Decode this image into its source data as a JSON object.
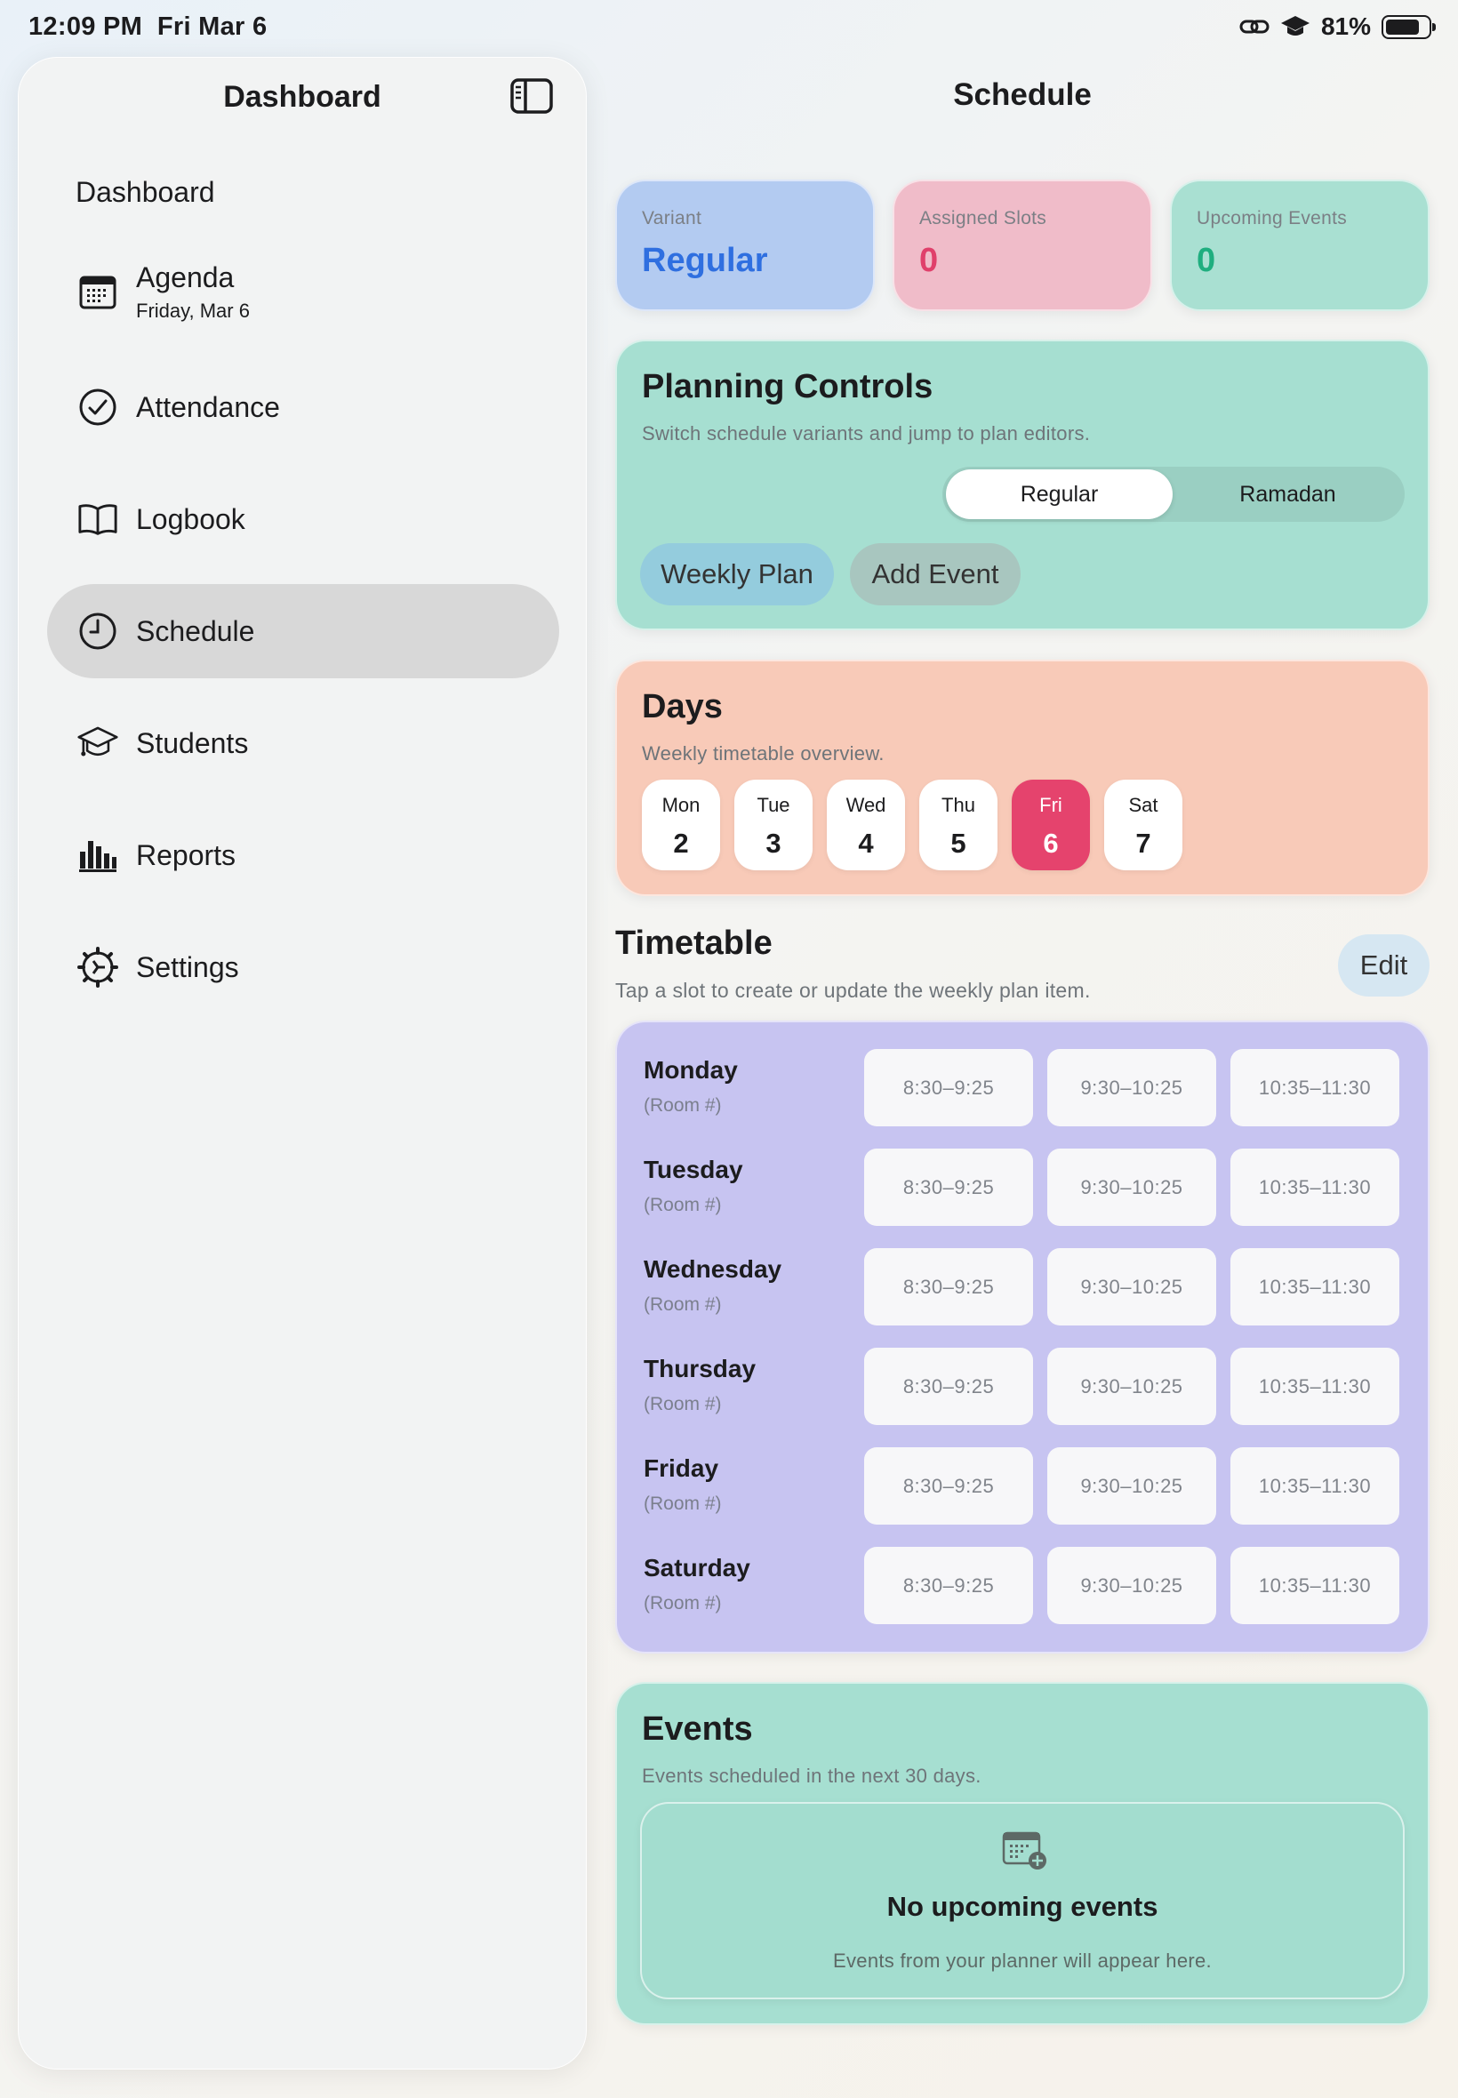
{
  "status_bar": {
    "time": "12:09 PM",
    "date": "Fri Mar 6",
    "battery": "81%",
    "battery_level": 0.81
  },
  "sidebar": {
    "title": "Dashboard",
    "section": "Dashboard",
    "items": [
      {
        "label": "Agenda",
        "sub": "Friday, Mar 6",
        "icon": "calendar-icon"
      },
      {
        "label": "Attendance",
        "icon": "checkmark-circle-icon"
      },
      {
        "label": "Logbook",
        "icon": "book-icon"
      },
      {
        "label": "Schedule",
        "icon": "clock-icon",
        "active": true
      },
      {
        "label": "Students",
        "icon": "graduation-cap-icon"
      },
      {
        "label": "Reports",
        "icon": "bar-chart-icon"
      },
      {
        "label": "Settings",
        "icon": "gear-icon"
      }
    ]
  },
  "main": {
    "title": "Schedule",
    "stats": [
      {
        "label": "Variant",
        "value": "Regular",
        "color": "#2f6fe0",
        "bg": "#b3cbf1"
      },
      {
        "label": "Assigned Slots",
        "value": "0",
        "color": "#e0406b",
        "bg": "#f0bcc9"
      },
      {
        "label": "Upcoming Events",
        "value": "0",
        "color": "#1fae7f",
        "bg": "#a9e0d2"
      }
    ],
    "planning": {
      "title": "Planning Controls",
      "subtitle": "Switch schedule variants and jump to plan editors.",
      "variants": [
        "Regular",
        "Ramadan"
      ],
      "selected_variant": "Regular",
      "buttons": [
        "Weekly Plan",
        "Add Event"
      ]
    },
    "days": {
      "title": "Days",
      "subtitle": "Weekly timetable overview.",
      "items": [
        {
          "name": "Mon",
          "num": "2"
        },
        {
          "name": "Tue",
          "num": "3"
        },
        {
          "name": "Wed",
          "num": "4"
        },
        {
          "name": "Thu",
          "num": "5"
        },
        {
          "name": "Fri",
          "num": "6",
          "today": true
        },
        {
          "name": "Sat",
          "num": "7"
        }
      ]
    },
    "timetable": {
      "title": "Timetable",
      "subtitle": "Tap a slot to create or update the weekly plan item.",
      "edit_label": "Edit",
      "rows": [
        {
          "day": "Monday",
          "room": "(Room #)",
          "slots": [
            "8:30–9:25",
            "9:30–10:25",
            "10:35–11:30"
          ]
        },
        {
          "day": "Tuesday",
          "room": "(Room #)",
          "slots": [
            "8:30–9:25",
            "9:30–10:25",
            "10:35–11:30"
          ]
        },
        {
          "day": "Wednesday",
          "room": "(Room #)",
          "slots": [
            "8:30–9:25",
            "9:30–10:25",
            "10:35–11:30"
          ]
        },
        {
          "day": "Thursday",
          "room": "(Room #)",
          "slots": [
            "8:30–9:25",
            "9:30–10:25",
            "10:35–11:30"
          ]
        },
        {
          "day": "Friday",
          "room": "(Room #)",
          "slots": [
            "8:30–9:25",
            "9:30–10:25",
            "10:35–11:30"
          ]
        },
        {
          "day": "Saturday",
          "room": "(Room #)",
          "slots": [
            "8:30–9:25",
            "9:30–10:25",
            "10:35–11:30"
          ]
        }
      ]
    },
    "events": {
      "title": "Events",
      "subtitle": "Events scheduled in the next 30 days.",
      "empty_title": "No upcoming events",
      "empty_subtitle": "Events from your planner will appear here.",
      "empty_icon": "calendar-add-icon"
    }
  }
}
